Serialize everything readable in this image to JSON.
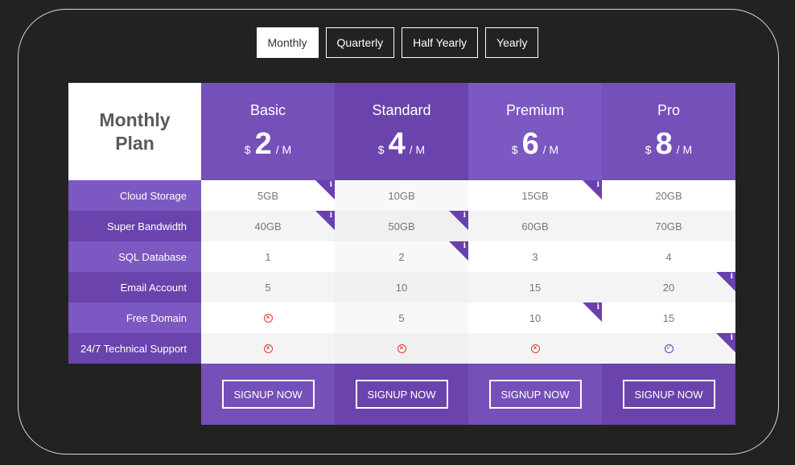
{
  "tabs": [
    {
      "label": "Monthly",
      "active": true
    },
    {
      "label": "Quarterly",
      "active": false
    },
    {
      "label": "Half Yearly",
      "active": false
    },
    {
      "label": "Yearly",
      "active": false
    }
  ],
  "table_title": "Monthly\nPlan",
  "currency": "$",
  "period": "/ M",
  "colors": {
    "purple_dark": "#6a43ac",
    "purple_mid": "#7450b8",
    "purple_light": "#7b58c2",
    "row_alt": "#f4f4f4",
    "no_icon": "#e03a3a",
    "yes_icon": "#6a3fb0"
  },
  "plans": [
    {
      "name": "Basic",
      "price": "2",
      "signup_label": "SIGNUP NOW"
    },
    {
      "name": "Standard",
      "price": "4",
      "signup_label": "SIGNUP NOW"
    },
    {
      "name": "Premium",
      "price": "6",
      "signup_label": "SIGNUP NOW"
    },
    {
      "name": "Pro",
      "price": "8",
      "signup_label": "SIGNUP NOW"
    }
  ],
  "info_glyph": "i",
  "rows": [
    {
      "label": "Cloud Storage",
      "values": [
        "5GB",
        "10GB",
        "15GB",
        "20GB"
      ],
      "info": [
        true,
        false,
        true,
        false
      ]
    },
    {
      "label": "Super Bandwidth",
      "values": [
        "40GB",
        "50GB",
        "60GB",
        "70GB"
      ],
      "info": [
        true,
        true,
        false,
        false
      ]
    },
    {
      "label": "SQL Database",
      "values": [
        "1",
        "2",
        "3",
        "4"
      ],
      "info": [
        false,
        true,
        false,
        false
      ]
    },
    {
      "label": "Email Account",
      "values": [
        "5",
        "10",
        "15",
        "20"
      ],
      "info": [
        false,
        false,
        false,
        true
      ]
    },
    {
      "label": "Free Domain",
      "values": [
        "no",
        "5",
        "10",
        "15"
      ],
      "info": [
        false,
        false,
        true,
        false
      ]
    },
    {
      "label": "24/7 Technical Support",
      "values": [
        "no",
        "no",
        "no",
        "yes"
      ],
      "info": [
        false,
        false,
        false,
        true
      ]
    }
  ],
  "icons": {
    "no": "x-circle-icon",
    "yes": "check-circle-icon"
  }
}
